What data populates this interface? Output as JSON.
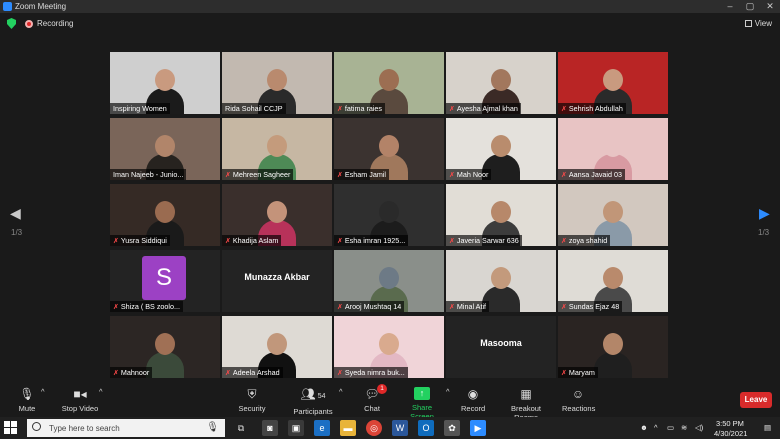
{
  "window": {
    "title": "Zoom Meeting"
  },
  "meeting": {
    "recording_label": "Recording",
    "view_label": "View"
  },
  "pagination": {
    "left": "1/3",
    "right": "1/3"
  },
  "participants_grid": [
    {
      "name": "Inspiring Women",
      "muted": false,
      "kind": "video",
      "bg": "#cfcfcf",
      "skin": "#c99a7f",
      "cloth": "#1b1b1b"
    },
    {
      "name": "Rida Sohail CCJP",
      "muted": false,
      "kind": "video",
      "bg": "#c2b9b0",
      "skin": "#b98a6e",
      "cloth": "#2a2a2a"
    },
    {
      "name": "fatima raies",
      "muted": true,
      "kind": "video",
      "bg": "#a8b394",
      "skin": "#9c6e52",
      "cloth": "#5a4a3e"
    },
    {
      "name": "Ayesha Ajmal khan",
      "muted": true,
      "kind": "video",
      "bg": "#d7d2cb",
      "skin": "#a2775d",
      "cloth": "#3b2a26"
    },
    {
      "name": "Sehrish Abdullah",
      "muted": true,
      "kind": "video",
      "bg": "#b92525",
      "skin": "#c99a7f",
      "cloth": "#2a2a2a"
    },
    {
      "name": "Iman Najeeb - Junio...",
      "muted": false,
      "kind": "video",
      "bg": "#7a6559",
      "skin": "#b1856a",
      "cloth": "#27231f",
      "active": true
    },
    {
      "name": "Mehreen Sagheer",
      "muted": true,
      "kind": "video",
      "bg": "#c6b7a3",
      "skin": "#c49b7c",
      "cloth": "#4e8a56"
    },
    {
      "name": "Esham Jamil",
      "muted": true,
      "kind": "video",
      "bg": "#3b3330",
      "skin": "#b38368",
      "cloth": "#a0785c"
    },
    {
      "name": "Mah Noor",
      "muted": true,
      "kind": "video",
      "bg": "#e4e1dc",
      "skin": "#b98c6d",
      "cloth": "#1e1e1e"
    },
    {
      "name": "Aansa Javaid 03",
      "muted": true,
      "kind": "video",
      "bg": "#e8c4c4",
      "skin": "#e8c4c4",
      "cloth": "#d89aa2"
    },
    {
      "name": "Yusra Siddiqui",
      "muted": true,
      "kind": "video",
      "bg": "#352a25",
      "skin": "#9a6b50",
      "cloth": "#1a1a1a"
    },
    {
      "name": "Khadija Aslam",
      "muted": true,
      "kind": "video",
      "bg": "#3a2f2c",
      "skin": "#c4937a",
      "cloth": "#b8325a"
    },
    {
      "name": "Esha imran 1925...",
      "muted": true,
      "kind": "video",
      "bg": "#2f2f2f",
      "skin": "#2a2a2a",
      "cloth": "#1c1c1c"
    },
    {
      "name": "Javeria Sarwar 636",
      "muted": true,
      "kind": "video",
      "bg": "#e1ddd6",
      "skin": "#b7886a",
      "cloth": "#3c3c3c"
    },
    {
      "name": "zoya shahid",
      "muted": true,
      "kind": "video",
      "bg": "#d2c8bf",
      "skin": "#c19678",
      "cloth": "#8a9aa8"
    },
    {
      "name": "Shiza ( BS zoolo...",
      "muted": true,
      "kind": "avatar",
      "initial": "S"
    },
    {
      "name": "",
      "muted": false,
      "kind": "text",
      "label": "Munazza Akbar"
    },
    {
      "name": "Arooj Mushtaq 14",
      "muted": true,
      "kind": "video",
      "bg": "#8a8f8a",
      "skin": "#6d7a86",
      "cloth": "#5a6b4e"
    },
    {
      "name": "Minal Atif",
      "muted": true,
      "kind": "video",
      "bg": "#d9d6d1",
      "skin": "#c39a7c",
      "cloth": "#2a2a2a"
    },
    {
      "name": "Sundas Ejaz 48",
      "muted": true,
      "kind": "video",
      "bg": "#dfdcd6",
      "skin": "#b98a6c",
      "cloth": "#4a4a4a"
    },
    {
      "name": "Mahnoor",
      "muted": true,
      "kind": "video",
      "bg": "#2c2624",
      "skin": "#a07055",
      "cloth": "#3b4a3a"
    },
    {
      "name": "Adeela Arshad",
      "muted": true,
      "kind": "video",
      "bg": "#dedad4",
      "skin": "#c1977b",
      "cloth": "#111111"
    },
    {
      "name": "Syeda nimra buk...",
      "muted": true,
      "kind": "video",
      "bg": "#f0d4d8",
      "skin": "#d9aa8e",
      "cloth": "#e3b8c4"
    },
    {
      "name": "",
      "muted": false,
      "kind": "text",
      "label": "Masooma"
    },
    {
      "name": "Maryam",
      "muted": true,
      "kind": "video",
      "bg": "#2a2422",
      "skin": "#b38669",
      "cloth": "#1f1f1f"
    }
  ],
  "toolbar": {
    "mute": "Mute",
    "stop_video": "Stop Video",
    "security": "Security",
    "participants": "Participants",
    "participant_count": "54",
    "chat": "Chat",
    "chat_badge": "1",
    "share_screen": "Share Screen",
    "record": "Record",
    "breakout": "Breakout Rooms",
    "reactions": "Reactions",
    "leave": "Leave"
  },
  "taskbar": {
    "search_placeholder": "Type here to search",
    "time": "3:50 PM",
    "date": "4/30/2021"
  },
  "colors": {
    "accent": "#2d8cff",
    "share_green": "#23d160",
    "leave_red": "#d82b2b",
    "active_speaker": "#c8e05a"
  }
}
